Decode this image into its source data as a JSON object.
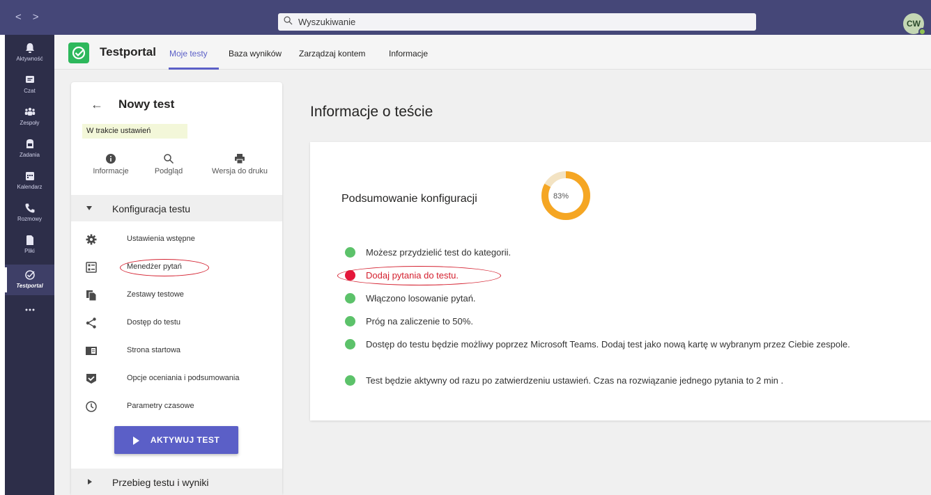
{
  "topbar": {
    "search_placeholder": "Wyszukiwanie",
    "avatar_initials": "CW",
    "color": "#454778"
  },
  "rail": {
    "items": [
      {
        "label": "Aktywność",
        "icon": "bell-icon"
      },
      {
        "label": "Czat",
        "icon": "chat-icon"
      },
      {
        "label": "Zespoły",
        "icon": "teams-icon"
      },
      {
        "label": "Zadania",
        "icon": "assignments-icon"
      },
      {
        "label": "Kalendarz",
        "icon": "calendar-icon"
      },
      {
        "label": "Rozmowy",
        "icon": "phone-icon"
      },
      {
        "label": "Pliki",
        "icon": "files-icon"
      },
      {
        "label": "Testportal",
        "icon": "testportal-icon"
      },
      {
        "label": "...",
        "icon": "more-icon"
      }
    ]
  },
  "app": {
    "name": "Testportal",
    "accent": "#5b5fc7",
    "tabs": [
      "Moje testy",
      "Baza wyników",
      "Zarządzaj kontem",
      "Informacje"
    ]
  },
  "panel": {
    "title": "Nowy test",
    "status": "W trakcie ustawień",
    "actions": [
      {
        "label": "Informacje",
        "icon": "info-icon"
      },
      {
        "label": "Podgląd",
        "icon": "search-icon"
      },
      {
        "label": "Wersja do druku",
        "icon": "printer-icon"
      }
    ],
    "section1": "Konfiguracja testu",
    "menu": [
      {
        "label": "Ustawienia wstępne",
        "icon": "gear-icon"
      },
      {
        "label": "Menedżer pytań",
        "icon": "question-manager-icon"
      },
      {
        "label": "Zestawy testowe",
        "icon": "copy-icon"
      },
      {
        "label": "Dostęp do testu",
        "icon": "share-icon"
      },
      {
        "label": "Strona startowa",
        "icon": "start-page-icon"
      },
      {
        "label": "Opcje oceniania i podsumowania",
        "icon": "check-shield-icon"
      },
      {
        "label": "Parametry czasowe",
        "icon": "clock-icon"
      }
    ],
    "activate_label": "AKTYWUJ TEST",
    "section2": "Przebieg testu i wyniki"
  },
  "content": {
    "title": "Informacje o teście",
    "summary_title": "Podsumowanie konfiguracji",
    "progress_percent": 83,
    "progress_label": "83%",
    "progress_color": "#f5a623",
    "items": [
      {
        "text": "Możesz przydzielić test do kategorii.",
        "status": "ok"
      },
      {
        "text": "Dodaj pytania do testu.",
        "status": "error"
      },
      {
        "text": "Włączono losowanie pytań.",
        "status": "ok"
      },
      {
        "text": "Próg na zaliczenie to 50%.",
        "status": "ok"
      },
      {
        "text": "Dostęp do testu będzie możliwy poprzez Microsoft Teams. Dodaj test jako nową kartę w wybranym przez Ciebie zespole.",
        "status": "ok"
      },
      {
        "text": "Test będzie aktywny od razu po zatwierdzeniu ustawień. Czas na rozwiązanie jednego pytania to 2 min .",
        "status": "ok"
      }
    ],
    "ok_color": "#5cc26a",
    "error_color": "#e4163a"
  }
}
